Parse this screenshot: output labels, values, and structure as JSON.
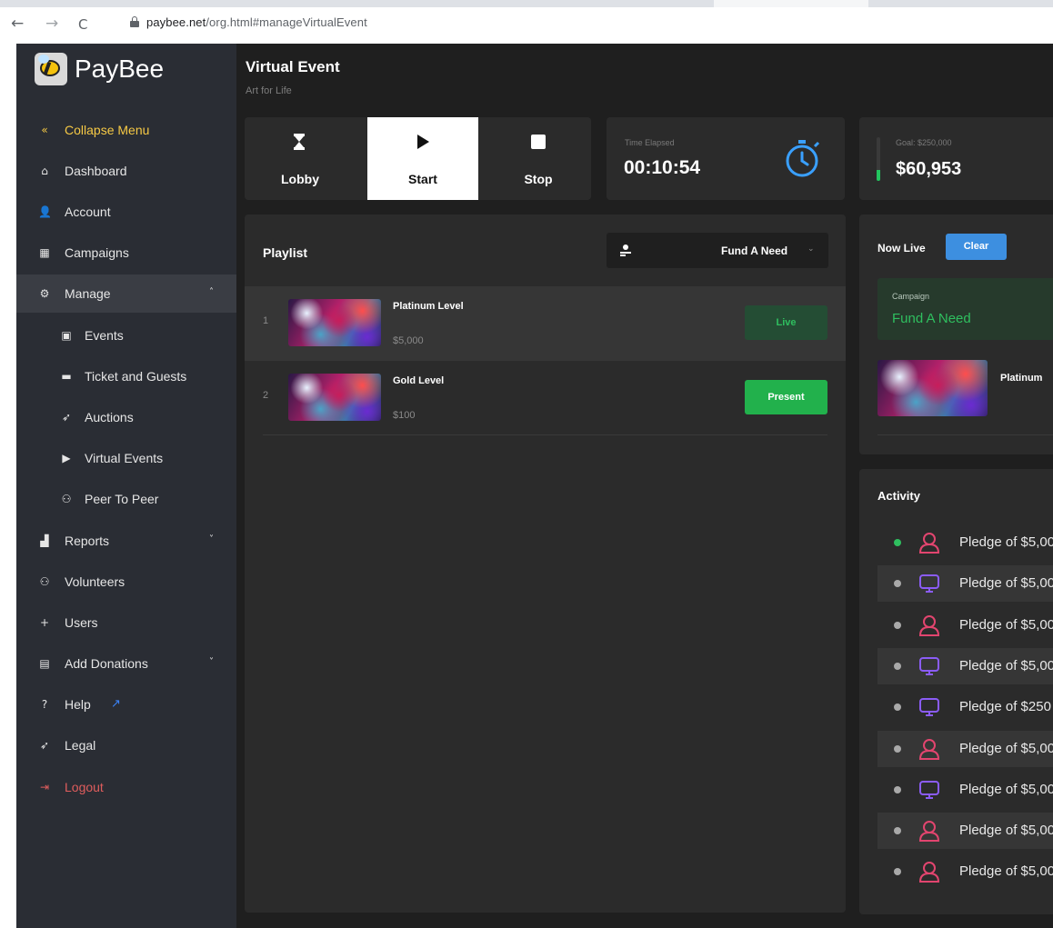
{
  "browser": {
    "back": "←",
    "forward": "→",
    "reload": "C",
    "url_host": "paybee.net",
    "url_path": "/org.html#manageVirtualEvent"
  },
  "brand": {
    "name": "PayBee"
  },
  "sidebar": {
    "items": [
      {
        "label": "Collapse Menu",
        "icon": "double-chevron-left-icon",
        "glyph": "«"
      },
      {
        "label": "Dashboard",
        "icon": "home-icon",
        "glyph": "⌂"
      },
      {
        "label": "Account",
        "icon": "user-edit-icon",
        "glyph": "👤"
      },
      {
        "label": "Campaigns",
        "icon": "grid-icon",
        "glyph": "▦"
      },
      {
        "label": "Manage",
        "icon": "users-cog-icon",
        "glyph": "⚙",
        "expanded": true
      },
      {
        "label": "Events",
        "icon": "calendar-icon",
        "glyph": "▣"
      },
      {
        "label": "Ticket and Guests",
        "icon": "ticket-icon",
        "glyph": "▬"
      },
      {
        "label": "Auctions",
        "icon": "gavel-icon",
        "glyph": "➶"
      },
      {
        "label": "Virtual Events",
        "icon": "video-icon",
        "glyph": "▶"
      },
      {
        "label": "Peer To Peer",
        "icon": "users-icon",
        "glyph": "⚇"
      },
      {
        "label": "Reports",
        "icon": "chart-area-icon",
        "glyph": "▟"
      },
      {
        "label": "Volunteers",
        "icon": "users-icon",
        "glyph": "⚇"
      },
      {
        "label": "Users",
        "icon": "user-plus-icon",
        "glyph": "+"
      },
      {
        "label": "Add Donations",
        "icon": "inbox-icon",
        "glyph": "▤"
      },
      {
        "label": "Help",
        "icon": "question-circle-icon",
        "glyph": "?"
      },
      {
        "label": "Legal",
        "icon": "gavel-icon",
        "glyph": "➶"
      },
      {
        "label": "Logout",
        "icon": "sign-out-icon",
        "glyph": "⇥"
      }
    ],
    "chevron_up": "˄",
    "chevron_down": "˅",
    "external_link_glyph": "↗"
  },
  "header": {
    "title": "Virtual Event",
    "subtitle": "Art for Life"
  },
  "controls": {
    "lobby": "Lobby",
    "start": "Start",
    "stop": "Stop"
  },
  "timer": {
    "label": "Time Elapsed",
    "value": "00:10:54"
  },
  "goal": {
    "label": "Goal: $250,000",
    "value": "$60,953",
    "progress_fraction": 0.24,
    "accent": "#22c55e"
  },
  "playlist": {
    "title": "Playlist",
    "filter_value": "Fund A Need",
    "filter_chevron": "⌄",
    "items": [
      {
        "index": "1",
        "name": "Platinum Level",
        "price": "$5,000",
        "action": "Live"
      },
      {
        "index": "2",
        "name": "Gold Level",
        "price": "$100",
        "action": "Present"
      }
    ]
  },
  "now_live": {
    "title": "Now Live",
    "clear": "Clear",
    "campaign_label": "Campaign",
    "campaign_value": "Fund A Need",
    "item_name": "Platinum"
  },
  "activity": {
    "title": "Activity",
    "rows": [
      {
        "text": "Pledge of $5,00",
        "source": "person",
        "status": "green"
      },
      {
        "text": "Pledge of $5,00",
        "source": "screen",
        "status": "grey"
      },
      {
        "text": "Pledge of $5,00",
        "source": "person",
        "status": "grey"
      },
      {
        "text": "Pledge of $5,00",
        "source": "screen",
        "status": "grey"
      },
      {
        "text": "Pledge of $250",
        "source": "screen",
        "status": "grey"
      },
      {
        "text": "Pledge of $5,00",
        "source": "person",
        "status": "grey"
      },
      {
        "text": "Pledge of $5,00",
        "source": "screen",
        "status": "grey"
      },
      {
        "text": "Pledge of $5,00",
        "source": "person",
        "status": "grey"
      },
      {
        "text": "Pledge of $5,00",
        "source": "person",
        "status": "grey"
      }
    ]
  },
  "colors": {
    "accent_green": "#22b14c",
    "accent_blue": "#3d8fe0",
    "collapse_yellow": "#f6c945",
    "logout_red": "#e05d5d",
    "person_icon": "#e2456f",
    "screen_icon": "#8b5cf6"
  }
}
